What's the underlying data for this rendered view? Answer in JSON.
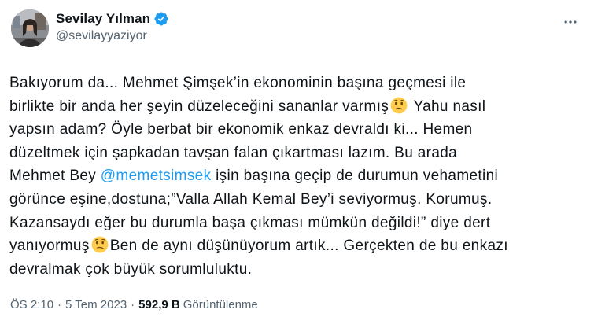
{
  "author": {
    "display_name": "Sevilay Yılman",
    "handle": "@sevilayyaziyor",
    "verified": true
  },
  "tweet": {
    "lines": [
      {
        "before": "Bakıyorum da... Mehmet Şimşek’in ekonominin başına geçmesi ile"
      },
      {
        "before": "birlikte bir anda her şeyin düzeleceğini sananlar varmış",
        "emoji": "thinking-face-emoji",
        "after": " Yahu nasıl"
      },
      {
        "before": "yapsın adam? Öyle berbat bir ekonomik enkaz devraldı ki... Hemen"
      },
      {
        "before": "düzeltmek için şapkadan tavşan falan çıkartması  lazım. Bu arada"
      },
      {
        "before": "Mehmet Bey ",
        "mention": "@memetsimsek",
        "after": " işin başına geçip de durumun vehametini"
      },
      {
        "before": "görünce eşine,dostuna;”Valla Allah Kemal Bey’i seviyormuş. Korumuş."
      },
      {
        "before": "Kazansaydı eğer bu durumla başa çıkması mümkün değildi!” diye dert"
      },
      {
        "before": "yanıyormuş",
        "emoji": "thinking-face-emoji",
        "after": "Ben de aynı düşünüyorum artık... Gerçekten de bu enkazı"
      },
      {
        "before": "devralmak çok büyük sorumluluktu."
      }
    ]
  },
  "meta": {
    "time": "ÖS 2:10",
    "separator": "·",
    "date": "5 Tem 2023",
    "views_count": "592,9 B",
    "views_label": "Görüntülenme"
  },
  "colors": {
    "text": "#0f1419",
    "secondary": "#536471",
    "accent": "#1d9bf0"
  },
  "icons": {
    "verified": "verified-badge-icon",
    "more": "more-options-icon",
    "emoji": "thinking-face-emoji"
  }
}
